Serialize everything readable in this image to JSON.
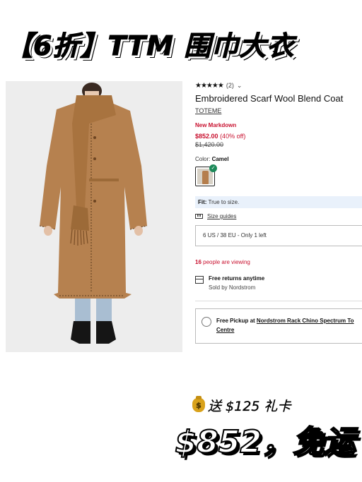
{
  "headline": "【6折】TTM 围巾大衣",
  "product": {
    "rating_stars": "★★★★★",
    "review_count": "(2)",
    "rating_chevron": "⌄",
    "title": "Embroidered Scarf Wool Blend Coat",
    "brand": "TOTEME",
    "markdown_label": "New Markdown",
    "sale_price": "$852.00",
    "discount": "(40% off)",
    "original_price": "$1,420.00",
    "color_label": "Color:",
    "color_value": "Camel",
    "swatch_check": "✓",
    "fit_label": "Fit:",
    "fit_value": "True to size.",
    "size_guides": "Size guides",
    "selected_size": "6 US / 38 EU - Only 1 left",
    "viewing_count": "16",
    "viewing_text": "people are viewing",
    "returns_title": "Free returns anytime",
    "returns_sub": "Sold by Nordstrom",
    "pickup_prefix": "Free Pickup at",
    "pickup_store": "Nordstrom Rack Chino Spectrum To",
    "pickup_store_cont": "Centre"
  },
  "promo": {
    "gift_icon": "$",
    "gift_text": "送 $125 礼卡",
    "bottom_text": "$852，免运"
  },
  "colors": {
    "sale_red": "#c8102e",
    "fit_banner": "#e9f1fb",
    "coat_camel": "#b57e4d",
    "check_green": "#1d8a5a"
  }
}
